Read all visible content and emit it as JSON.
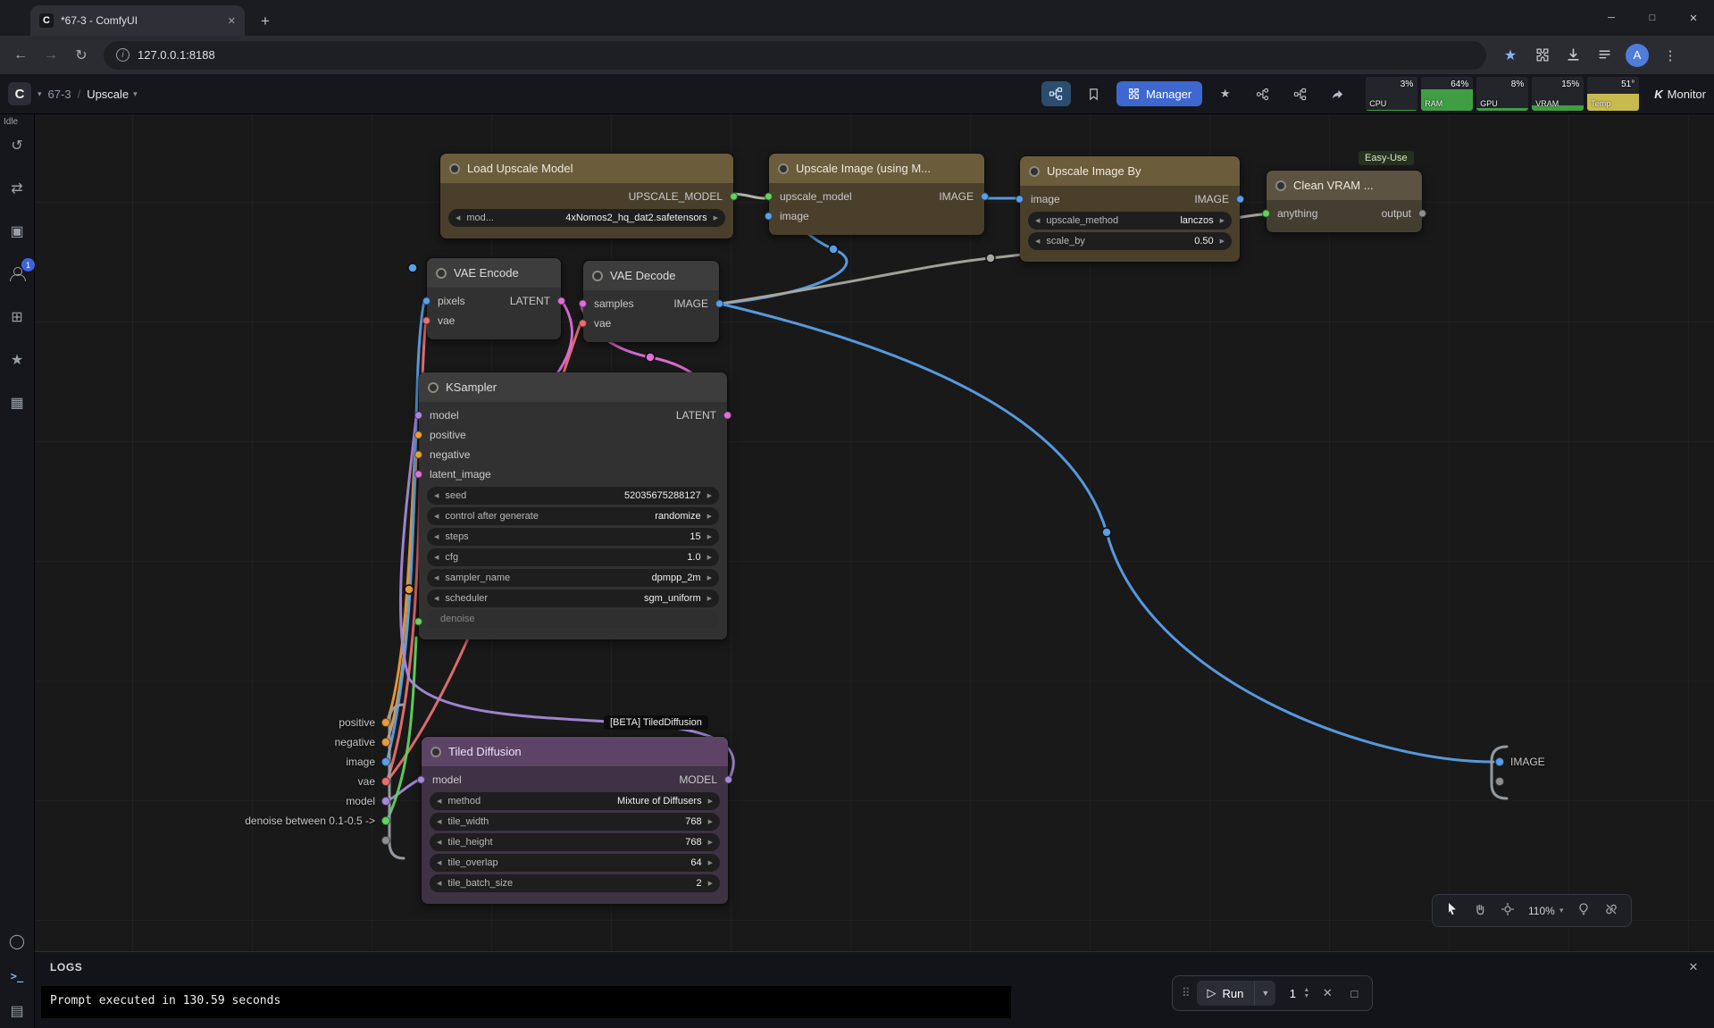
{
  "browser": {
    "tab_title": "*67-3 - ComfyUI",
    "url": "127.0.0.1:8188",
    "profile_initial": "A"
  },
  "comfy_header": {
    "workflow_id": "67-3",
    "breadcrumb_separator": "/",
    "workflow_name": "Upscale",
    "manager_label": "Manager",
    "monitor_brand": "K",
    "monitor_label": "Monitor",
    "stats": [
      {
        "label": "CPU",
        "value": "3%",
        "fill": 3,
        "color": "#3f9e44"
      },
      {
        "label": "RAM",
        "value": "64%",
        "fill": 64,
        "color": "#3f9e44"
      },
      {
        "label": "GPU",
        "value": "8%",
        "fill": 8,
        "color": "#3f9e44"
      },
      {
        "label": "VRAM",
        "value": "15%",
        "fill": 15,
        "color": "#3f9e44"
      },
      {
        "label": "Temp",
        "value": "51°",
        "fill": 51,
        "color": "#c9ba4e"
      }
    ]
  },
  "sidebar": {
    "queue_badge": "1"
  },
  "status_label": "Idle",
  "nodes": {
    "load_upscale_model": {
      "title": "Load Upscale Model",
      "output_label": "UPSCALE_MODEL",
      "widget": {
        "label": "mod...",
        "value": "4xNomos2_hq_dat2.safetensors"
      }
    },
    "upscale_image_using_model": {
      "title": "Upscale Image (using M...",
      "input1": "upscale_model",
      "input2": "image",
      "output_label": "IMAGE"
    },
    "upscale_image_by": {
      "title": "Upscale Image By",
      "input1": "image",
      "output_label": "IMAGE",
      "widgets": [
        {
          "label": "upscale_method",
          "value": "lanczos"
        },
        {
          "label": "scale_by",
          "value": "0.50"
        }
      ]
    },
    "clean_vram": {
      "badge": "Easy-Use",
      "title": "Clean VRAM ...",
      "input1": "anything",
      "output_label": "output"
    },
    "vae_encode": {
      "title": "VAE Encode",
      "input1": "pixels",
      "input2": "vae",
      "output_label": "LATENT"
    },
    "vae_decode": {
      "title": "VAE Decode",
      "input1": "samples",
      "input2": "vae",
      "output_label": "IMAGE"
    },
    "ksampler": {
      "title": "KSampler",
      "input1": "model",
      "input2": "positive",
      "input3": "negative",
      "input4": "latent_image",
      "output_label": "LATENT",
      "widgets": [
        {
          "label": "seed",
          "value": "52035675288127"
        },
        {
          "label": "control after generate",
          "value": "randomize"
        },
        {
          "label": "steps",
          "value": "15"
        },
        {
          "label": "cfg",
          "value": "1.0"
        },
        {
          "label": "sampler_name",
          "value": "dpmpp_2m"
        },
        {
          "label": "scheduler",
          "value": "sgm_uniform"
        }
      ],
      "disabled_widget": "denoise"
    },
    "tiled_diffusion": {
      "badge": "[BETA] TiledDiffusion",
      "title": "Tiled Diffusion",
      "input1": "model",
      "output_label": "MODEL",
      "widgets": [
        {
          "label": "method",
          "value": "Mixture of Diffusers"
        },
        {
          "label": "tile_width",
          "value": "768"
        },
        {
          "label": "tile_height",
          "value": "768"
        },
        {
          "label": "tile_overlap",
          "value": "64"
        },
        {
          "label": "tile_batch_size",
          "value": "2"
        }
      ]
    }
  },
  "group_io": {
    "inputs": [
      {
        "label": "positive"
      },
      {
        "label": "negative"
      },
      {
        "label": "image"
      },
      {
        "label": "vae"
      },
      {
        "label": "model"
      },
      {
        "label": "denoise between 0.1-0.5 ->"
      }
    ],
    "output_label": "IMAGE"
  },
  "canvas_toolbar": {
    "zoom": "110%"
  },
  "logs_panel": {
    "title": "LOGS",
    "log_line": "Prompt executed in 130.59 seconds"
  },
  "run_controls": {
    "run_label": "Run",
    "batch_count": "1"
  }
}
